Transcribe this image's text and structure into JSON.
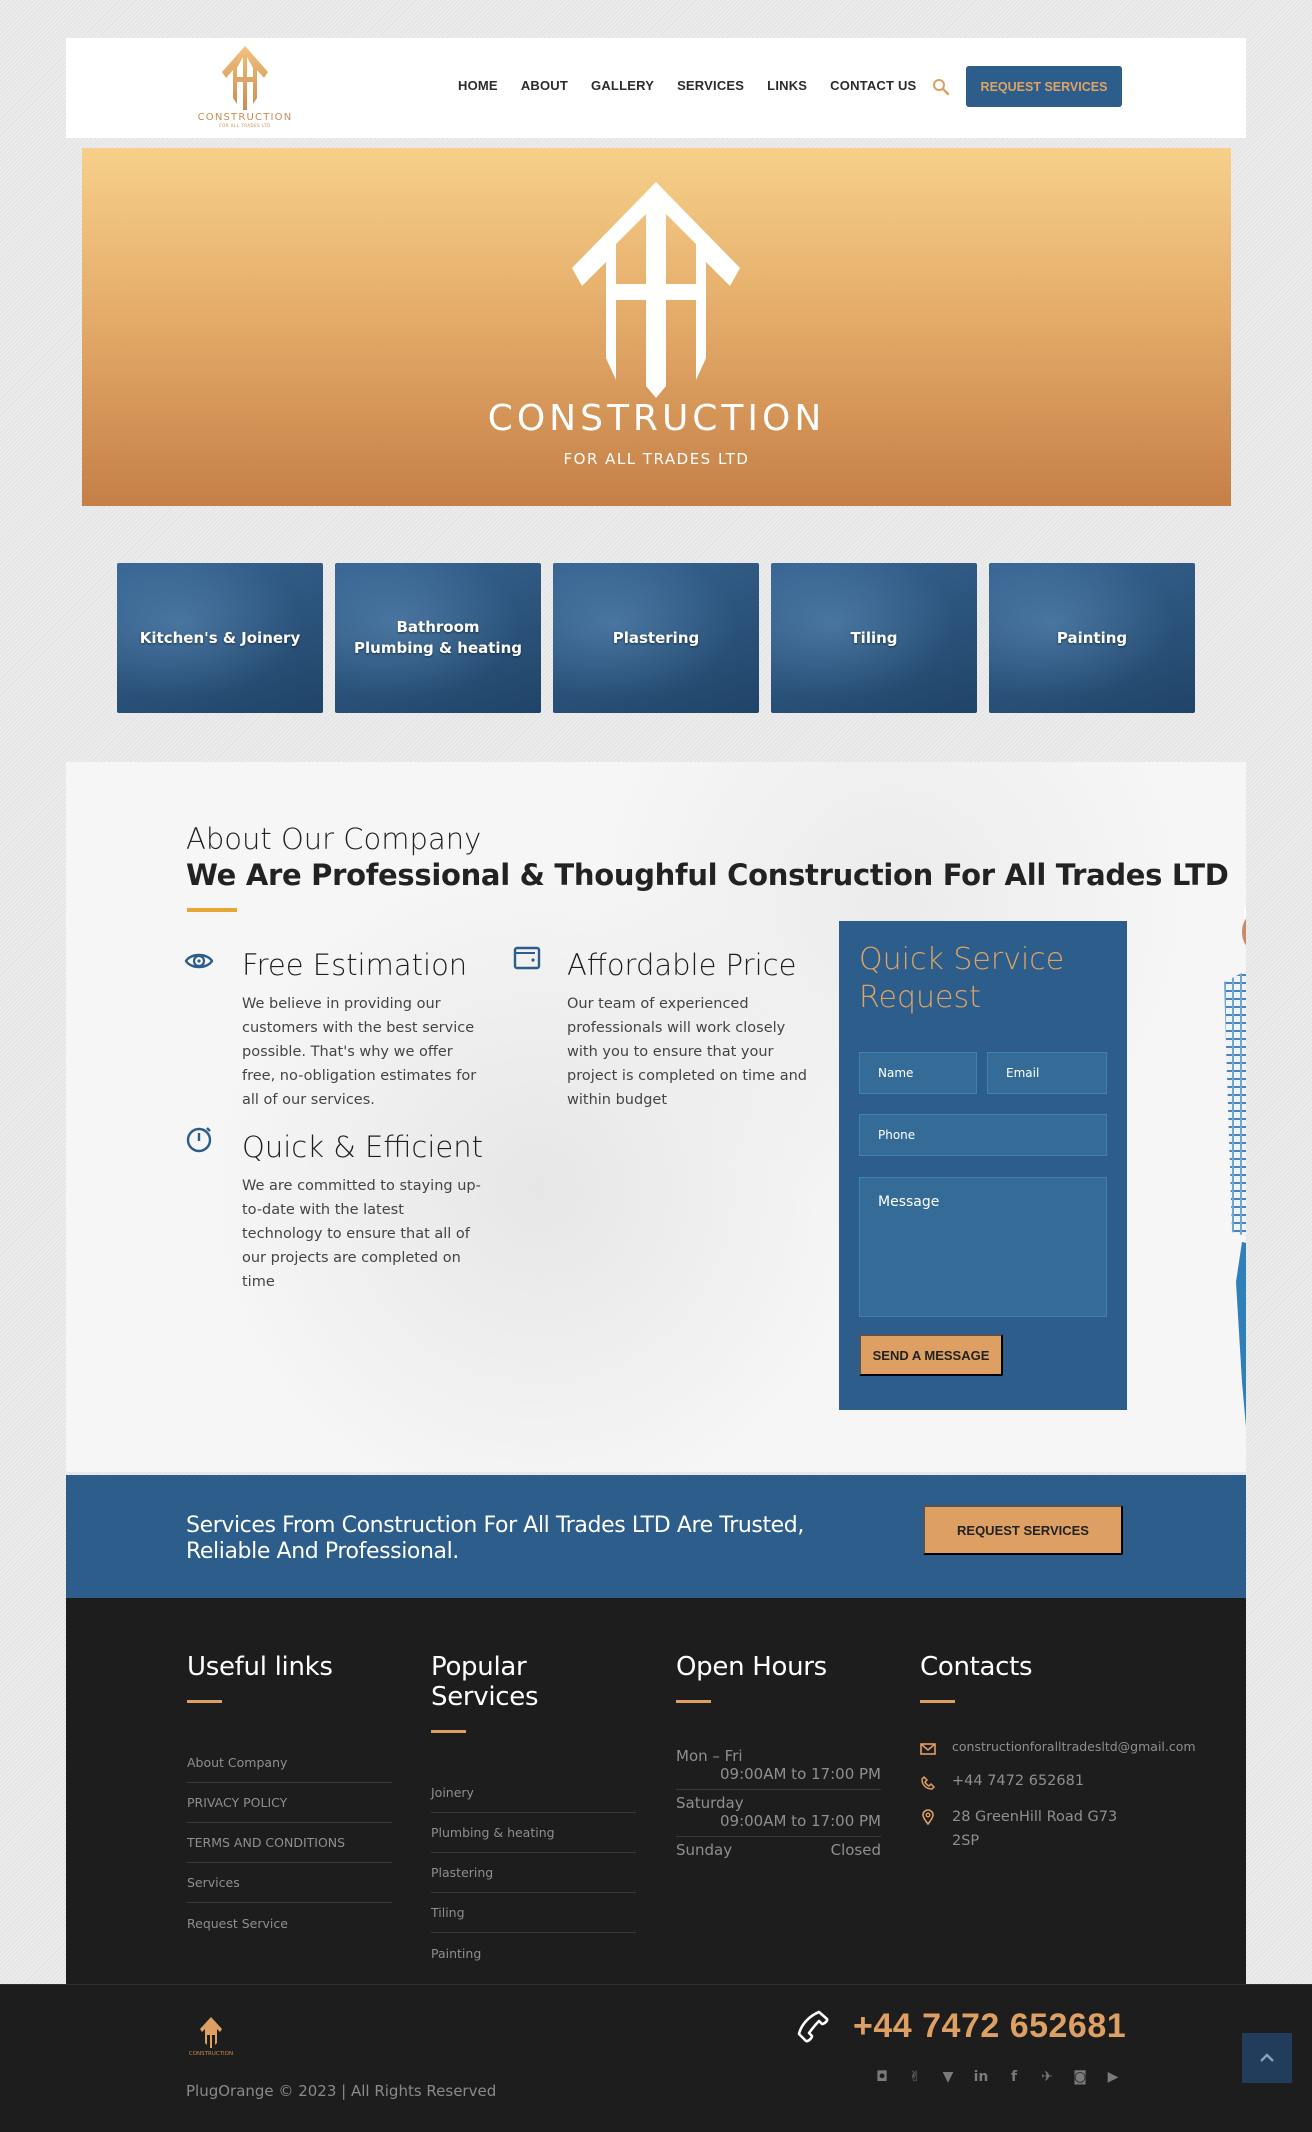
{
  "header": {
    "logo": {
      "name": "CONSTRUCTION",
      "tagline": "FOR ALL TRADES LTD"
    },
    "nav": [
      "HOME",
      "ABOUT",
      "GALLERY",
      "SERVICES",
      "LINKS",
      "CONTACT US"
    ],
    "search_icon": "search-icon",
    "request_button": "REQUEST SERVICES"
  },
  "hero": {
    "title": "CONSTRUCTION",
    "subtitle": "FOR ALL TRADES LTD"
  },
  "service_tiles": [
    {
      "label": "Kitchen's & Joinery"
    },
    {
      "label": "Bathroom\nPlumbing & heating"
    },
    {
      "label": "Plastering"
    },
    {
      "label": "Tiling"
    },
    {
      "label": "Painting"
    }
  ],
  "about": {
    "kicker": "About Our Company",
    "title": "We Are Professional & Thoughful Construction For All Trades LTD",
    "features": [
      {
        "icon": "eye-icon",
        "title": "Free Estimation",
        "text": "We believe in providing our customers with the best service possible. That's why we offer free, no-obligation estimates for all of our services."
      },
      {
        "icon": "wallet-icon",
        "title": "Affordable Price",
        "text": "Our team of experienced professionals will work closely with you to ensure that your project is completed on time and within budget"
      },
      {
        "icon": "stopwatch-icon",
        "title": "Quick & Efficient",
        "text": "We are committed to staying up-to-date with the latest technology to ensure that all of our projects are completed on time"
      }
    ],
    "form": {
      "title": "Quick Service Request",
      "name_placeholder": "Name",
      "email_placeholder": "Email",
      "phone_placeholder": "Phone",
      "message_placeholder": "Message",
      "submit": "SEND A MESSAGE"
    }
  },
  "cta": {
    "text": "Services From Construction For All Trades LTD Are Trusted, Reliable And Professional.",
    "button": "REQUEST SERVICES"
  },
  "footer": {
    "useful_links": {
      "title": "Useful links",
      "items": [
        "About Company",
        "PRIVACY POLICY",
        "TERMS AND CONDITIONS",
        "Services",
        "Request Service"
      ]
    },
    "popular_services": {
      "title": "Popular Services",
      "items": [
        "Joinery",
        "Plumbing & heating",
        "Plastering",
        "Tiling",
        "Painting"
      ]
    },
    "open_hours": {
      "title": "Open Hours",
      "rows": [
        {
          "day": "Mon – Fri",
          "time": "09:00AM to 17:00 PM"
        },
        {
          "day": "Saturday",
          "time": "09:00AM to 17:00 PM"
        },
        {
          "day": "Sunday",
          "time": "Closed"
        }
      ]
    },
    "contacts": {
      "title": "Contacts",
      "email": "constructionforalltradesltd@gmail.com",
      "phone": "+44 7472 652681",
      "address": "28 GreenHill Road G73 2SP"
    }
  },
  "bottom": {
    "logo_text": "CONSTRUCTION",
    "copyright": "PlugOrange © 2023 | All Rights Reserved",
    "phone": "+44 7472 652681",
    "socials": [
      "delicious-icon",
      "peace-icon",
      "gitlab-icon",
      "linkedin-icon",
      "facebook-icon",
      "twitter-icon",
      "instagram-icon",
      "youtube-icon"
    ]
  },
  "colors": {
    "primary_blue": "#2d5d8b",
    "accent_orange": "#dea062",
    "footer_dark": "#1d1d1d",
    "gold_underline": "#e7a735"
  }
}
